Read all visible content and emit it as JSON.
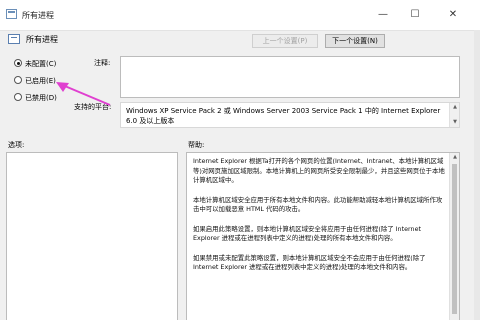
{
  "window": {
    "title": "所有进程",
    "minimize_glyph": "—",
    "maximize_glyph": "☐",
    "close_glyph": "✕"
  },
  "header": {
    "title": "所有进程",
    "prev_label": "上一个设置(P)",
    "next_label": "下一个设置(N)"
  },
  "options": [
    {
      "label": "未配置(C)",
      "selected": true
    },
    {
      "label": "已启用(E)",
      "selected": false
    },
    {
      "label": "已禁用(D)",
      "selected": false
    }
  ],
  "comment_label": "注释:",
  "supported_label": "支持的平台:",
  "supported_text": "Windows XP Service Pack 2 或 Windows Server 2003 Service Pack 1 中的 Internet Explorer 6.0 及以上版本",
  "options_label": "选项:",
  "help_label": "帮助:",
  "help_paragraphs": [
    "Internet Explorer 根据Ta打开的各个网页的位置(Internet、Intranet、本地计算机区域等)对网页施加区域限制。本地计算机上的网页所受安全限制最少，并且这些网页位于本地计算机区域中。",
    "本地计算机区域安全应用于所有本地文件和内容。此功能帮助减轻本地计算机区域所作攻击中可以加载恶意 HTML 代码的攻击。",
    "如果启用此策略设置，则本地计算机区域安全将应用于由任何进程(除了 Internet Explorer 进程或在进程列表中定义的进程)处理的所有本地文件和内容。",
    "如果禁用或未配置此策略设置，则本地计算机区域安全不会应用于由任何进程(除了 Internet Explorer 进程或在进程列表中定义的进程)处理的本地文件和内容。"
  ],
  "annotation": {
    "color": "#e040d0"
  }
}
